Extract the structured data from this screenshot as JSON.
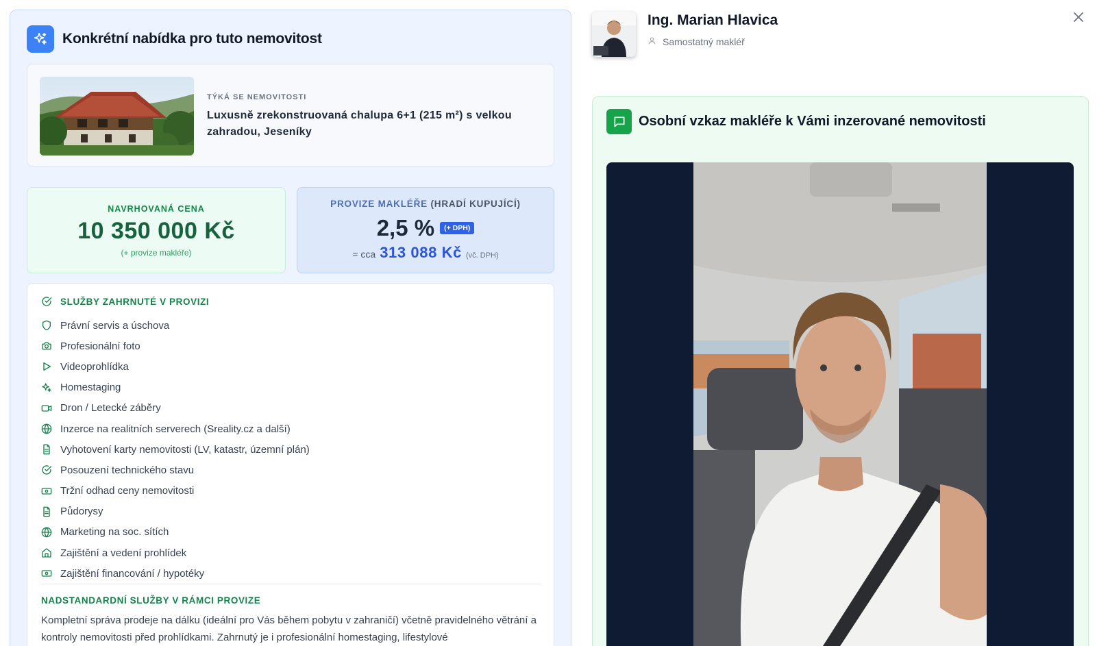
{
  "offer": {
    "title": "Konkrétní nabídka pro tuto nemovitost",
    "property": {
      "kicker": "TÝKÁ SE NEMOVITOSTI",
      "title": "Luxusně zrekonstruovaná chalupa 6+1 (215 m²) s velkou zahradou, Jeseníky"
    },
    "price": {
      "label": "NAVRHOVANÁ CENA",
      "value": "10 350 000 Kč",
      "note": "(+ provize makléře)"
    },
    "commission": {
      "label_main": "PROVIZE MAKLÉŘE",
      "label_sub": "(HRADÍ KUPUJÍCÍ)",
      "value": "2,5 %",
      "vat_badge": "(+ DPH)",
      "approx_label": "= cca",
      "amount": "313 088 Kč",
      "vat_note": "(vč. DPH)"
    },
    "services": {
      "heading": "SLUŽBY ZAHRNUTÉ V PROVIZI",
      "items": [
        {
          "label": "Právní servis a úschova",
          "icon": "shield-icon"
        },
        {
          "label": "Profesionální foto",
          "icon": "camera-icon"
        },
        {
          "label": "Videoprohlídka",
          "icon": "play-icon"
        },
        {
          "label": "Homestaging",
          "icon": "sparkles-icon"
        },
        {
          "label": "Dron / Letecké záběry",
          "icon": "video-camera-icon"
        },
        {
          "label": "Inzerce na realitních serverech (Sreality.cz a další)",
          "icon": "globe-icon"
        },
        {
          "label": "Vyhotovení karty nemovitosti (LV, katastr, územní plán)",
          "icon": "document-icon"
        },
        {
          "label": "Posouzení technického stavu",
          "icon": "check-circle-icon"
        },
        {
          "label": "Tržní odhad ceny nemovitosti",
          "icon": "banknote-icon"
        },
        {
          "label": "Půdorysy",
          "icon": "document-icon"
        },
        {
          "label": "Marketing na soc. sítích",
          "icon": "globe-icon"
        },
        {
          "label": "Zajištění a vedení prohlídek",
          "icon": "home-icon"
        },
        {
          "label": "Zajištění financování / hypotéky",
          "icon": "banknote-icon"
        }
      ]
    },
    "extra": {
      "heading": "NADSTANDARDNÍ SLUŽBY V RÁMCI PROVIZE",
      "text": "Kompletní správa prodeje na dálku (ideální pro Vás během pobytu v zahraničí) včetně pravidelného větrání a kontroly nemovitosti před prohlídkami. Zahrnutý je i profesionální homestaging, lifestylové"
    }
  },
  "agent": {
    "name": "Ing. Marian Hlavica",
    "role": "Samostatný makléř"
  },
  "message": {
    "title": "Osobní vzkaz makléře k Vámi inzerované nemovitosti"
  },
  "colors": {
    "accent_blue": "#3b82f6",
    "accent_green": "#16a34a",
    "price_green": "#16613e",
    "commission_blue": "#2c55d6"
  }
}
